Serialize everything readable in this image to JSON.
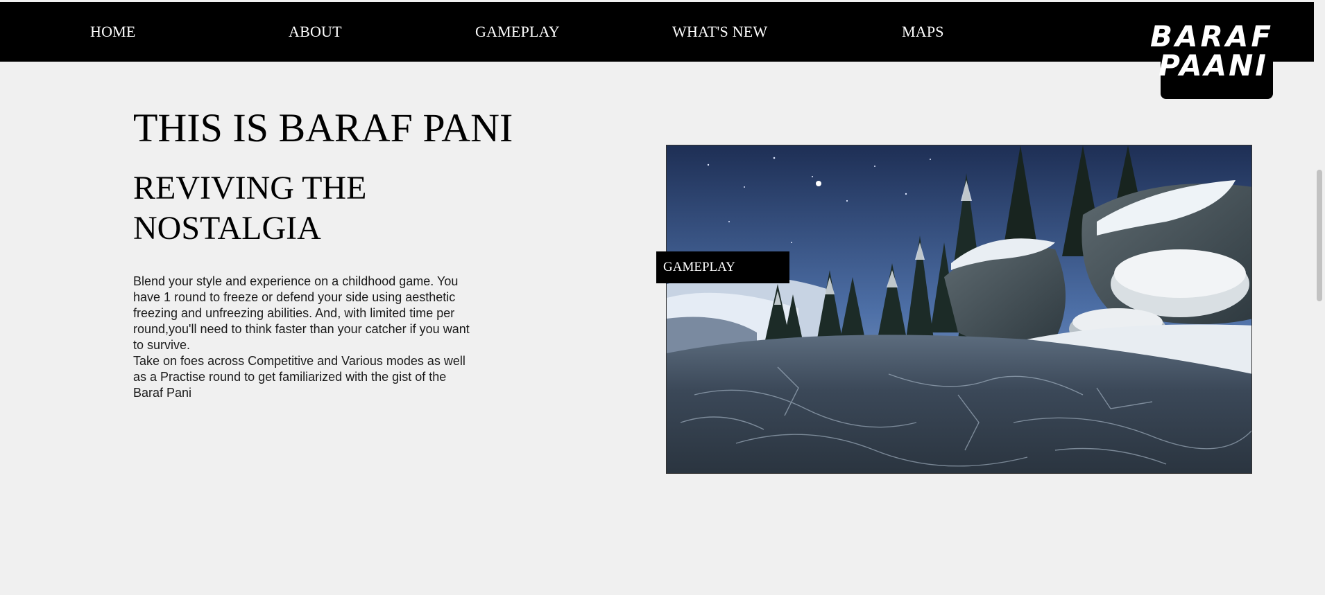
{
  "nav": {
    "items": [
      {
        "label": "HOME"
      },
      {
        "label": "ABOUT"
      },
      {
        "label": "GAMEPLAY"
      },
      {
        "label": "WHAT'S NEW"
      },
      {
        "label": "MAPS"
      }
    ],
    "logo_line1": "BARAF",
    "logo_line2": "PAANI"
  },
  "hero": {
    "title": "THIS IS BARAF PANI",
    "subtitle": "REVIVING THE NOSTALGIA",
    "description": "Blend your style and experience on a childhood game. You have 1 round to freeze or defend your side using aesthetic freezing and unfreezing abilities. And, with limited time per round,you'll need to think faster than your catcher if you want to survive.",
    "description2": "Take on foes across Competitive and Various modes as well as a Practise round to get familiarized with the gist of the Baraf Pani",
    "media_label": "GAMEPLAY"
  },
  "colors": {
    "nav_bg": "#000000",
    "page_bg": "#f0f0f0",
    "nav_text": "#ffffff"
  }
}
